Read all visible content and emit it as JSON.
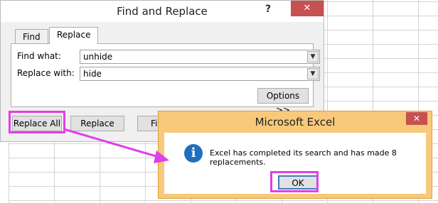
{
  "find_replace_dialog": {
    "title": "Find and Replace",
    "help_glyph": "?",
    "close_glyph": "✕",
    "tabs": [
      "Find",
      "Replace"
    ],
    "active_tab": "Replace",
    "find_what_label": "Find what:",
    "find_what_value": "unhide",
    "replace_with_label": "Replace with:",
    "replace_with_value": "hide",
    "options_button": "Options >>",
    "replace_all_button": "Replace All",
    "replace_button": "Replace",
    "find_button_partial": "Fi"
  },
  "message_box": {
    "title": "Microsoft Excel",
    "close_glyph": "✕",
    "icon": "information-icon",
    "icon_glyph": "i",
    "message": "Excel has completed its search and has made 8 replacements.",
    "ok_button": "OK"
  },
  "colors": {
    "highlight": "#e040e8",
    "excel_dialog_frame": "#f8c97b",
    "close_button": "#c75050",
    "info_icon": "#1f6fbf"
  }
}
